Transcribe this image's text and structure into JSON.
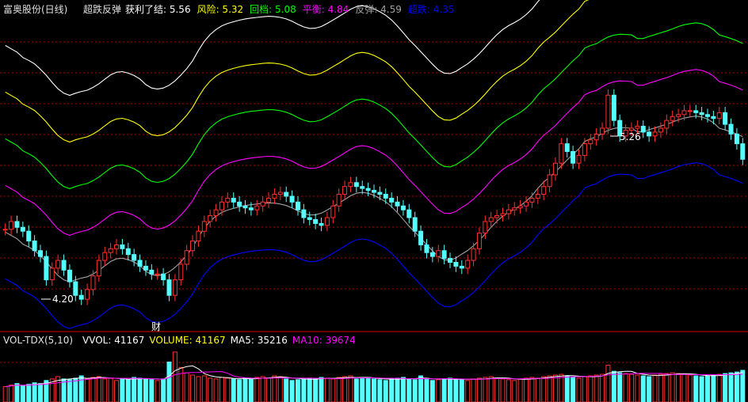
{
  "header": {
    "title": "富奥股份(日线)",
    "indicator": "超跌反弹",
    "items": [
      {
        "label": "获利了结:",
        "value": "5.56",
        "color": "#ffffff"
      },
      {
        "label": "风险:",
        "value": "5.32",
        "color": "#ffff00"
      },
      {
        "label": "回档:",
        "value": "5.08",
        "color": "#00ff00"
      },
      {
        "label": "平衡:",
        "value": "4.84",
        "color": "#ff00ff"
      },
      {
        "label": "反弹:",
        "value": "4.59",
        "color": "#a0a0a0"
      },
      {
        "label": "超跌:",
        "value": "4.35",
        "color": "#0000ff"
      }
    ]
  },
  "vol_header": {
    "name": "VOL-TDX(5,10)",
    "items": [
      {
        "label": "VVOL:",
        "value": "41167",
        "color": "#ffffff"
      },
      {
        "label": "VOLUME:",
        "value": "41167",
        "color": "#ffff00"
      },
      {
        "label": "MA5:",
        "value": "35216",
        "color": "#ffffff"
      },
      {
        "label": "MA10:",
        "value": "39674",
        "color": "#ff00ff"
      }
    ]
  },
  "annotations": {
    "high_label": "5.26",
    "low_label": "4.20",
    "fin_marker": "财"
  },
  "colors": {
    "up": "#ff3030",
    "down": "#54ffff",
    "grid": "#b00000",
    "bg": "#000000"
  },
  "chart_data": {
    "type": "candlestick",
    "ylim": [
      4.05,
      5.65
    ],
    "closes": [
      4.56,
      4.6,
      4.57,
      4.55,
      4.5,
      4.45,
      4.42,
      4.3,
      4.36,
      4.4,
      4.35,
      4.29,
      4.22,
      4.2,
      4.25,
      4.32,
      4.4,
      4.44,
      4.46,
      4.48,
      4.46,
      4.43,
      4.4,
      4.37,
      4.35,
      4.33,
      4.33,
      4.3,
      4.22,
      4.3,
      4.38,
      4.45,
      4.5,
      4.55,
      4.6,
      4.63,
      4.66,
      4.7,
      4.72,
      4.7,
      4.68,
      4.67,
      4.66,
      4.68,
      4.7,
      4.72,
      4.74,
      4.75,
      4.73,
      4.7,
      4.66,
      4.62,
      4.61,
      4.59,
      4.58,
      4.62,
      4.68,
      4.74,
      4.78,
      4.8,
      4.78,
      4.77,
      4.76,
      4.75,
      4.74,
      4.72,
      4.7,
      4.68,
      4.66,
      4.62,
      4.55,
      4.48,
      4.44,
      4.42,
      4.45,
      4.41,
      4.39,
      4.37,
      4.36,
      4.4,
      4.46,
      4.54,
      4.6,
      4.62,
      4.63,
      4.64,
      4.66,
      4.67,
      4.68,
      4.7,
      4.72,
      4.74,
      4.78,
      4.84,
      4.9,
      5.0,
      4.96,
      4.9,
      4.94,
      5.0,
      5.02,
      5.05,
      5.08,
      5.25,
      5.12,
      5.04,
      5.07,
      5.08,
      5.09,
      5.06,
      5.04,
      5.06,
      5.08,
      5.12,
      5.14,
      5.15,
      5.17,
      5.17,
      5.16,
      5.15,
      5.14,
      5.13,
      5.16,
      5.1,
      5.05,
      5.0,
      4.92
    ],
    "volumes": [
      20000,
      22000,
      24000,
      21000,
      23000,
      25000,
      24000,
      28000,
      30000,
      33000,
      30000,
      29000,
      31000,
      34000,
      30000,
      32000,
      33000,
      30000,
      31000,
      28000,
      30000,
      29000,
      32000,
      31000,
      30000,
      29000,
      28000,
      30000,
      52000,
      65000,
      45000,
      38000,
      35000,
      33000,
      34000,
      31000,
      30000,
      32000,
      31000,
      30000,
      29000,
      31000,
      30000,
      32000,
      33000,
      31000,
      34000,
      33000,
      30000,
      28000,
      29000,
      30000,
      31000,
      30000,
      32000,
      31000,
      30000,
      32000,
      33000,
      34000,
      30000,
      31000,
      32000,
      30000,
      29000,
      28000,
      30000,
      31000,
      32000,
      30000,
      29000,
      34000,
      30000,
      28000,
      29000,
      30000,
      31000,
      30000,
      29000,
      28000,
      30000,
      31000,
      32000,
      33000,
      31000,
      30000,
      29000,
      28000,
      30000,
      31000,
      32000,
      31000,
      33000,
      34000,
      35000,
      36000,
      34000,
      32000,
      31000,
      33000,
      34000,
      35000,
      36000,
      48000,
      40000,
      38000,
      37000,
      36000,
      35000,
      34000,
      33000,
      35000,
      36000,
      37000,
      38000,
      37000,
      36000,
      35000,
      34000,
      33000,
      34000,
      35000,
      36000,
      37000,
      38000,
      39000,
      41167
    ]
  }
}
